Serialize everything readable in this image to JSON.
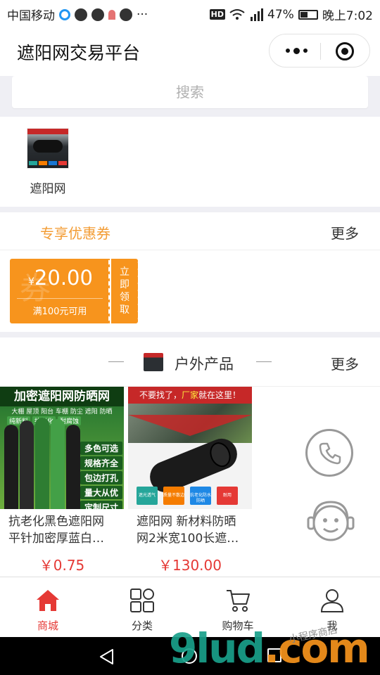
{
  "status_bar": {
    "carrier": "中国移动",
    "network_badge": "HD",
    "battery": "47%",
    "battery_level": 0.47,
    "time": "晚上7:02"
  },
  "header": {
    "title": "遮阳网交易平台"
  },
  "search": {
    "placeholder": "搜索"
  },
  "categories": [
    {
      "label": "遮阳网"
    }
  ],
  "coupons_section": {
    "title": "专享优惠券",
    "more": "更多",
    "coupons": [
      {
        "currency": "¥",
        "amount": "20.00",
        "condition": "满100元可用",
        "claim": "立即领取",
        "watermark": "券"
      }
    ]
  },
  "products_section": {
    "title": "户外产品",
    "more": "更多",
    "products": [
      {
        "name": "抗老化黑色遮阳网平针加密厚蓝白…",
        "price": "￥0.75",
        "image": {
          "headline": "加密遮阳网防晒网",
          "subline": "大棚 屋顶 阳台 车棚 防尘 遮阳 防晒",
          "tags": [
            "纯新料",
            "抗老化",
            "耐腐蚀"
          ],
          "features": [
            "多色可选",
            "规格齐全",
            "包边打孔",
            "量大从优",
            "定制尺寸"
          ]
        }
      },
      {
        "name": "遮阳网 新材料防晒网2米宽100长遮…",
        "price": "￥130.00",
        "image": {
          "headline_a": "不要找了，",
          "headline_b": "厂家",
          "headline_c": "就在这里！",
          "badges": [
            "遮光透气",
            "质量不散边",
            "抗老化防水防晒",
            "耐用"
          ]
        }
      }
    ]
  },
  "tab_bar": {
    "tabs": [
      {
        "label": "商城",
        "icon": "home-icon",
        "active": true
      },
      {
        "label": "分类",
        "icon": "category-grid-icon",
        "active": false
      },
      {
        "label": "购物车",
        "icon": "cart-icon",
        "active": false
      },
      {
        "label": "我",
        "icon": "user-icon",
        "active": false
      }
    ]
  },
  "watermark": {
    "text_a": "9lud",
    "text_b": ".com",
    "small": "小程序商店"
  },
  "colors": {
    "accent_orange": "#f7941d",
    "coupon_title": "#f39c34",
    "price_red": "#e53935",
    "active_tab": "#e53935"
  }
}
